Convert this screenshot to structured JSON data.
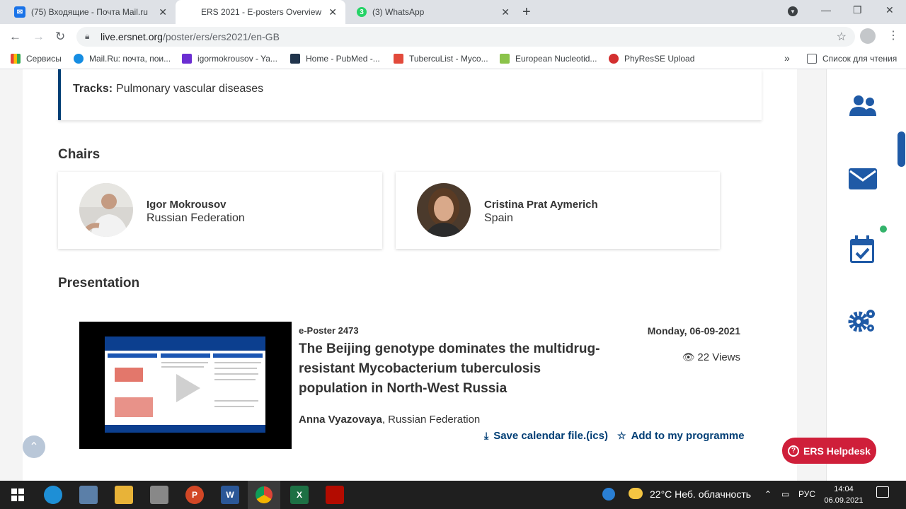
{
  "browser": {
    "tabs": [
      {
        "title": "(75) Входящие - Почта Mail.ru",
        "icon": "mail-icon"
      },
      {
        "title": "ERS 2021 - E-posters Overview",
        "icon": "ers-icon",
        "active": true
      },
      {
        "title": "(3) WhatsApp",
        "icon": "whatsapp-icon",
        "badge": "3"
      }
    ],
    "url_host": "live.ersnet.org",
    "url_path": "/poster/ers/ers2021/en-GB",
    "bookmarks": [
      "Сервисы",
      "Mail.Ru: почта, пои...",
      "igormokrousov - Ya...",
      "Home - PubMed -...",
      "TubercuList - Myco...",
      "European Nucleotid...",
      "PhyResSE Upload"
    ],
    "overflow": "»",
    "reading_list": "Список для чтения"
  },
  "page": {
    "tracks_label": "Tracks:",
    "tracks_value": "Pulmonary vascular diseases",
    "chairs_heading": "Chairs",
    "chairs": [
      {
        "name": "Igor Mokrousov",
        "country": "Russian Federation"
      },
      {
        "name": "Cristina Prat Aymerich",
        "country": "Spain"
      }
    ],
    "presentation_heading": "Presentation",
    "presentation": {
      "type": "e-Poster 2473",
      "title": "The Beijing genotype dominates the multidrug-resistant Mycobacterium tuberculosis population in North-West Russia",
      "author": "Anna Vyazovaya",
      "author_country": ", Russian Federation",
      "date": "Monday, 06-09-2021",
      "views": "22 Views",
      "save_calendar": "Save calendar file.(ics)",
      "add_programme": "Add to my programme"
    },
    "helpdesk": "ERS Helpdesk"
  },
  "taskbar": {
    "weather": "22°C  Неб. облачность",
    "lang": "РУС",
    "time": "14:04",
    "date": "06.09.2021"
  },
  "colors": {
    "brand_blue": "#003e75",
    "helpdesk_red": "#cf1f3a",
    "notif_green": "#33b36b"
  }
}
